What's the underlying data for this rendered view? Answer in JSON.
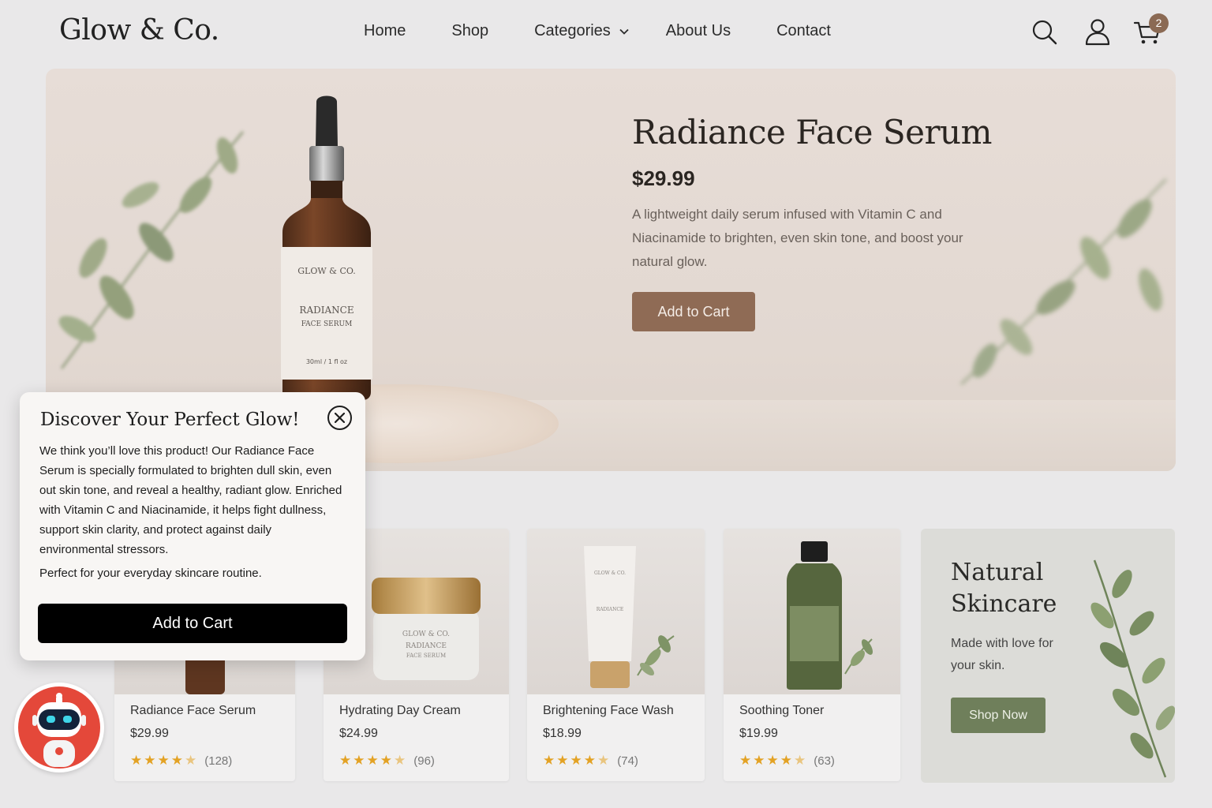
{
  "header": {
    "logo": "Glow & Co.",
    "nav": [
      "Home",
      "Shop",
      "Categories",
      "About Us",
      "Contact"
    ],
    "cart_count": "2",
    "icons": [
      "search-icon",
      "user-icon",
      "cart-icon"
    ]
  },
  "hero": {
    "title": "Radiance Face Serum",
    "price": "$29.99",
    "description": "A lightweight daily serum infused with Vitamin C and Niacinamide to brighten, even skin tone, and boost your natural glow.",
    "button": "Add to Cart",
    "bottle_label": {
      "brand": "GLOW & CO.",
      "name": "RADIANCE",
      "subname": "FACE SERUM",
      "volume": "30ml / 1 fl oz"
    }
  },
  "products": [
    {
      "name": "Radiance Face Serum",
      "price": "$29.99",
      "rating": 4.5,
      "count": "(128)"
    },
    {
      "name": "Hydrating Day Cream",
      "price": "$24.99",
      "rating": 4.5,
      "count": "(96)"
    },
    {
      "name": "Brightening Face Wash",
      "price": "$18.99",
      "rating": 4.5,
      "count": "(74)"
    },
    {
      "name": "Soothing Toner",
      "price": "$19.99",
      "rating": 4.5,
      "count": "(63)"
    }
  ],
  "promo": {
    "title": "Natural Skincare",
    "subtitle": "Made with love for your skin.",
    "button": "Shop Now"
  },
  "popup": {
    "title": "Discover Your Perfect Glow!",
    "body": "We think you’ll love this product! Our Radiance Face Serum is specially formulated to brighten dull skin, even out skin tone, and reveal a healthy, radiant glow. Enriched with Vitamin C and Niacinamide, it helps fight dullness, support skin clarity, and protect against daily environmental stressors.",
    "note": "Perfect for your everyday skincare routine.",
    "button": "Add to Cart"
  },
  "colors": {
    "accent_brown": "#8f6b55",
    "accent_green": "#6f7f5b",
    "chatbot_red": "#e4483a",
    "star": "#e3a224"
  }
}
